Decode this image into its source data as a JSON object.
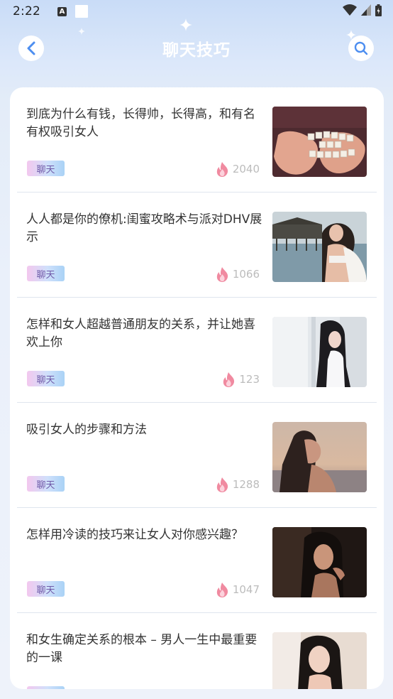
{
  "status_bar": {
    "time": "2:22",
    "a_icon_letter": "A"
  },
  "header": {
    "title": "聊天技巧"
  },
  "articles": [
    {
      "title": "到底为什么有钱，长得帅，长得高，和有名有权吸引女人",
      "tag": "聊天",
      "views": "2040",
      "thumb": "hands-forever-and-always-image"
    },
    {
      "title": "人人都是你的僚机:闺蜜攻略术与派对DHV展示",
      "tag": "聊天",
      "views": "1066",
      "thumb": "woman-by-lake-pavilion-image"
    },
    {
      "title": "怎样和女人超越普通朋友的关系，并让她喜欢上你",
      "tag": "聊天",
      "views": "123",
      "thumb": "woman-by-window-image"
    },
    {
      "title": "吸引女人的步骤和方法",
      "tag": "聊天",
      "views": "1288",
      "thumb": "woman-at-sunset-beach-image"
    },
    {
      "title": "怎样用冷读的技巧来让女人对你感兴趣？",
      "tag": "聊天",
      "views": "1047",
      "thumb": "woman-in-dim-light-image"
    },
    {
      "title": "和女生确定关系的根本 – 男人一生中最重要的一课",
      "tag": "聊天",
      "views": "",
      "thumb": "woman-portrait-image"
    }
  ],
  "colors": {
    "accent": "#6f5aa8",
    "fire": "#f08aa0",
    "title": "#333333",
    "views": "#bcbcbc"
  }
}
